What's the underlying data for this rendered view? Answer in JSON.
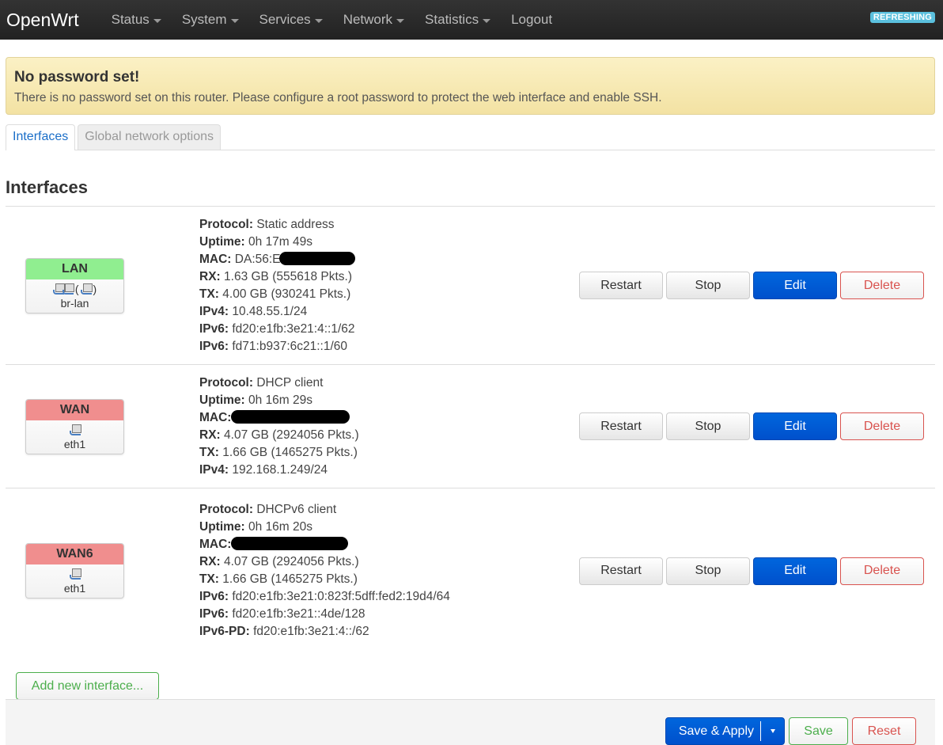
{
  "header": {
    "brand": "OpenWrt",
    "menu": [
      {
        "label": "Status",
        "dropdown": true
      },
      {
        "label": "System",
        "dropdown": true
      },
      {
        "label": "Services",
        "dropdown": true
      },
      {
        "label": "Network",
        "dropdown": true
      },
      {
        "label": "Statistics",
        "dropdown": true
      },
      {
        "label": "Logout",
        "dropdown": false
      }
    ],
    "status_badge": "REFRESHING"
  },
  "alert": {
    "title": "No password set!",
    "text": "There is no password set on this router. Please configure a root password to protect the web interface and enable SSH."
  },
  "tabs": [
    {
      "label": "Interfaces",
      "active": true
    },
    {
      "label": "Global network options",
      "active": false
    }
  ],
  "section_title": "Interfaces",
  "interfaces": [
    {
      "name": "LAN",
      "color": "#90ee90",
      "device": "br-lan",
      "icons": [
        "bridge-icon",
        "ethernet-port-icon"
      ],
      "protocol": "Static address",
      "uptime": "0h 17m 49s",
      "mac": "DA:56:E",
      "mac_redacted": true,
      "rx": "1.63 GB (555618 Pkts.)",
      "tx": "4.00 GB (930241 Pkts.)",
      "addresses": [
        {
          "label": "IPv4:",
          "value": "10.48.55.1/24"
        },
        {
          "label": "IPv6:",
          "value": "fd20:e1fb:3e21:4::1/62"
        },
        {
          "label": "IPv6:",
          "value": "fd71:b937:6c21::1/60"
        }
      ]
    },
    {
      "name": "WAN",
      "color": "#f08e8e",
      "device": "eth1",
      "icons": [
        "ethernet-port-icon"
      ],
      "protocol": "DHCP client",
      "uptime": "0h 16m 29s",
      "mac": "",
      "mac_redacted": true,
      "rx": "4.07 GB (2924056 Pkts.)",
      "tx": "1.66 GB (1465275 Pkts.)",
      "addresses": [
        {
          "label": "IPv4:",
          "value": "192.168.1.249/24"
        }
      ]
    },
    {
      "name": "WAN6",
      "color": "#f08e8e",
      "device": "eth1",
      "icons": [
        "ethernet-port-icon"
      ],
      "protocol": "DHCPv6 client",
      "uptime": "0h 16m 20s",
      "mac": "",
      "mac_redacted": true,
      "rx": "4.07 GB (2924056 Pkts.)",
      "tx": "1.66 GB (1465275 Pkts.)",
      "addresses": [
        {
          "label": "IPv6:",
          "value": "fd20:e1fb:3e21:0:823f:5dff:fed2:19d4/64"
        },
        {
          "label": "IPv6:",
          "value": "fd20:e1fb:3e21::4de/128"
        },
        {
          "label": "IPv6-PD:",
          "value": "fd20:e1fb:3e21:4::/62"
        }
      ]
    }
  ],
  "labels": {
    "protocol": "Protocol:",
    "uptime": "Uptime:",
    "mac": "MAC:",
    "rx": "RX:",
    "tx": "TX:"
  },
  "row_actions": {
    "restart": "Restart",
    "stop": "Stop",
    "edit": "Edit",
    "delete": "Delete"
  },
  "add_interface": "Add new interface...",
  "footer": {
    "save_apply": "Save & Apply",
    "save": "Save",
    "reset": "Reset"
  }
}
